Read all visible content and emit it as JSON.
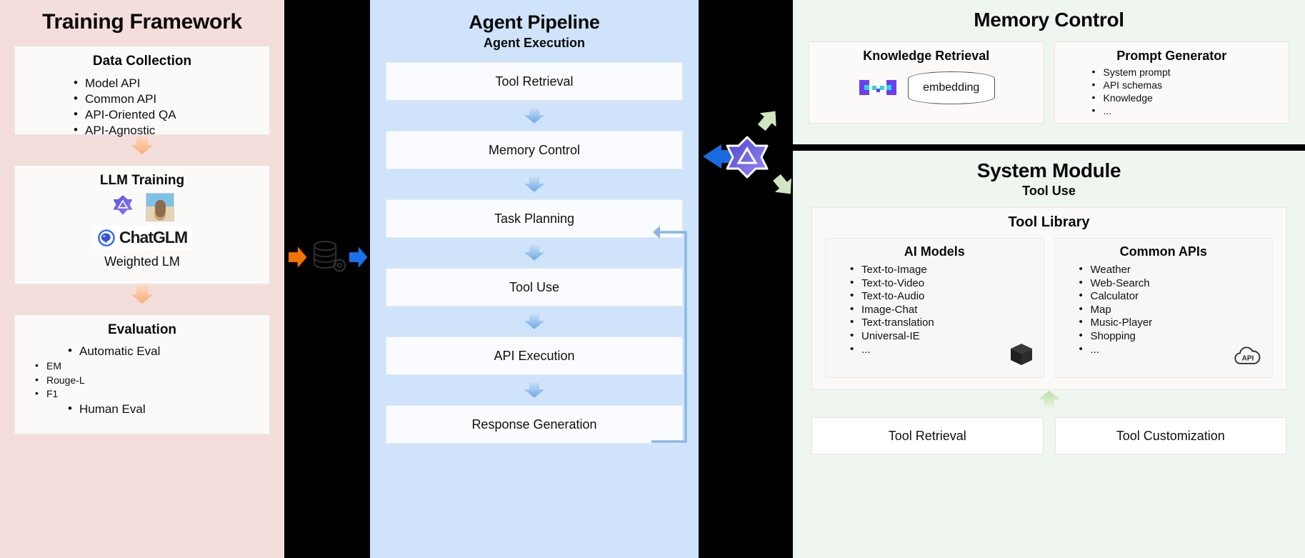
{
  "colors": {
    "training_bg": "#f4dedc",
    "pipeline_bg": "#cfe4fa",
    "memory_bg": "#eff5ef",
    "system_bg": "#eff5ef",
    "card_bg": "#fbfaf9",
    "arrow_peach": "#fbc9a4",
    "arrow_blue": "#9cc7f0",
    "arrow_green": "#cfe6c0",
    "arrow_orange": "#f57200",
    "arrow_solid_blue": "#1a73e8",
    "glm_purple": "#6c5ce7",
    "background": "#000000"
  },
  "training_framework": {
    "title": "Training Framework",
    "data_collection": {
      "title": "Data Collection",
      "items": [
        "Model API",
        "Common API",
        "API-Oriented QA",
        "API-Agnostic"
      ]
    },
    "llm_training": {
      "title": "LLM Training",
      "logos": [
        "glm-logo-icon",
        "llama-image-icon",
        "chatglm-logo-icon"
      ],
      "chatglm_label": "ChatGLM",
      "caption": "Weighted LM"
    },
    "evaluation": {
      "title": "Evaluation",
      "items": [
        "Automatic Eval",
        "Human Eval"
      ],
      "sub_items": [
        "EM",
        "Rouge-L",
        "F1"
      ]
    }
  },
  "agent_pipeline": {
    "title": "Agent Pipeline",
    "subtitle": "Agent Execution",
    "stages": [
      "Tool Retrieval",
      "Memory Control",
      "Task Planning",
      "Tool Use",
      "API Execution",
      "Response Generation"
    ]
  },
  "memory_control": {
    "title": "Memory Control",
    "knowledge_retrieval": {
      "title": "Knowledge Retrieval",
      "db_label": "embedding",
      "logo": "pixel-logo-icon"
    },
    "prompt_generator": {
      "title": "Prompt Generator",
      "items": [
        "System prompt",
        "API schemas",
        "Knowledge",
        "..."
      ]
    }
  },
  "system_module": {
    "title": "System Module",
    "subtitle": "Tool Use",
    "tool_library": {
      "title": "Tool Library",
      "ai_models": {
        "title": "AI Models",
        "items": [
          "Text-to-Image",
          "Text-to-Video",
          "Text-to-Audio",
          "Image-Chat",
          "Text-translation",
          "Universal-IE",
          "..."
        ],
        "icon": "cube-icon"
      },
      "common_apis": {
        "title": "Common APIs",
        "items": [
          "Weather",
          "Web-Search",
          "Calculator",
          "Map",
          "Music-Player",
          "Shopping",
          "..."
        ],
        "icon": "api-cloud-icon"
      }
    },
    "buttons": [
      "Tool Retrieval",
      "Tool Customization"
    ]
  },
  "connectors": {
    "data_icon": "database-gear-icon",
    "center_logo": "glm-logo-icon",
    "arrows": [
      "arrow-right-orange",
      "arrow-right-blue",
      "arrow-left-blue",
      "arrow-green-up-right",
      "arrow-green-down-right"
    ]
  }
}
